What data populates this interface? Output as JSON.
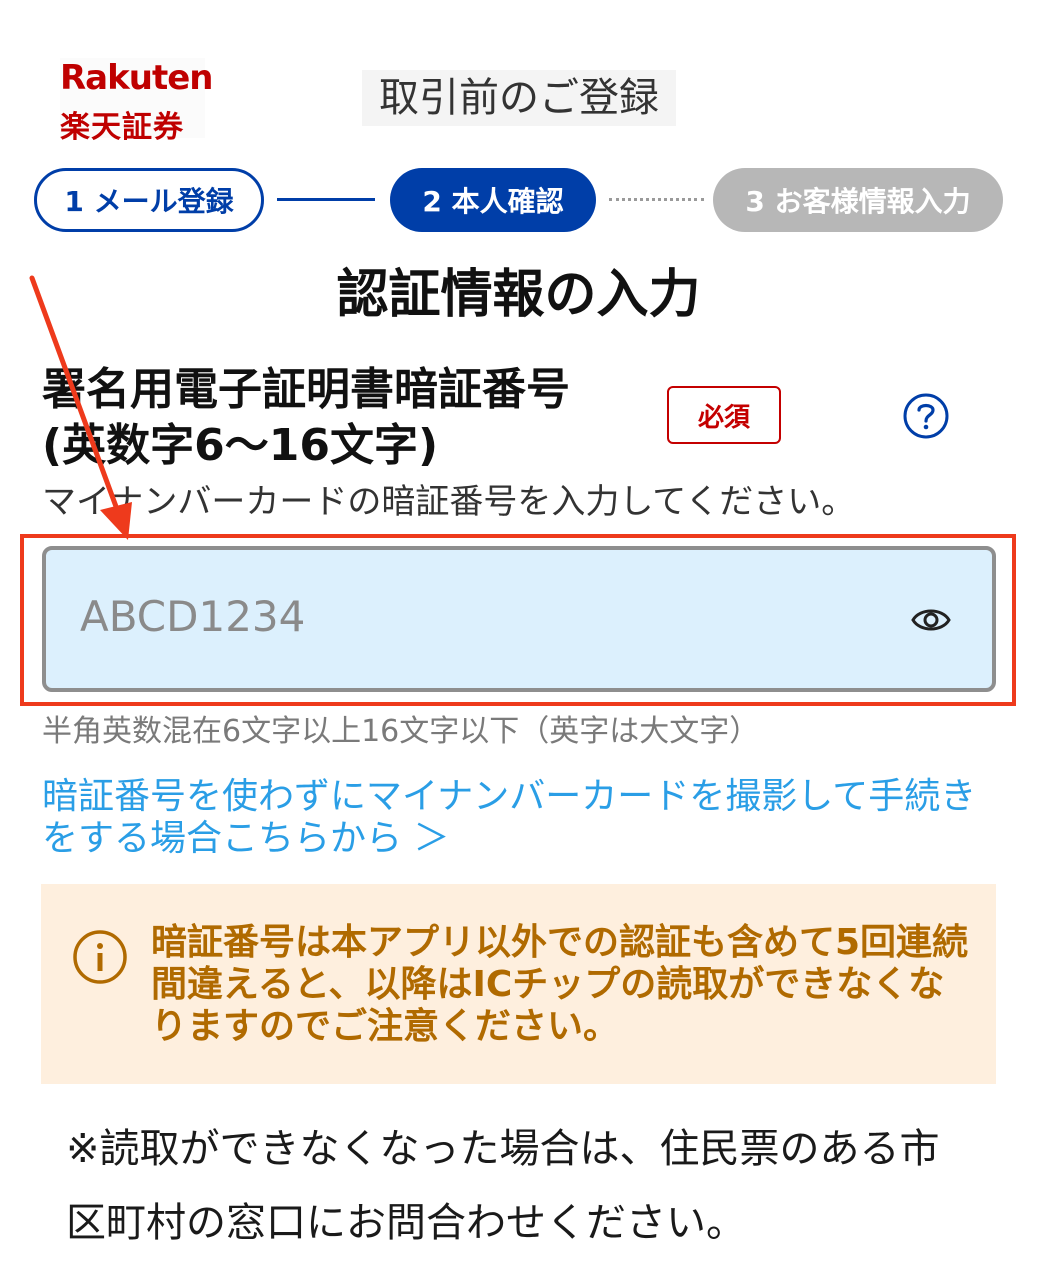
{
  "header": {
    "logo_en": "Rakuten",
    "logo_jp": "楽天証券",
    "title": "取引前のご登録"
  },
  "stepper": {
    "steps": [
      {
        "label": "1 メール登録",
        "state": "completed"
      },
      {
        "label": "2 本人確認",
        "state": "current"
      },
      {
        "label": "3 お客様情報入力",
        "state": "upcoming"
      }
    ]
  },
  "section_title": "認証情報の入力",
  "field": {
    "label_line1": "署名用電子証明書暗証番号",
    "label_line2": "(英数字6〜16文字)",
    "required": "必須",
    "help_icon": "question-circle-icon",
    "description": "マイナンバーカードの暗証番号を入力してください。",
    "placeholder": "ABCD1234",
    "toggle_icon": "eye-icon",
    "hint": "半角英数混在6文字以上16文字以下（英字は大文字）"
  },
  "link_text": "暗証番号を使わずにマイナンバーカードを撮影して手続きをする場合こちらから ＞",
  "warning": {
    "icon": "info-circle-icon",
    "text": "暗証番号は本アプリ以外での認証も含めて5回連続間違えると、以降はICチップの読取ができなくなりますのでご注意ください。"
  },
  "note": "※読取ができなくなった場合は、住民票のある市区町村の窓口にお問合わせください。",
  "colors": {
    "brand_red": "#bf0000",
    "primary_blue": "#003ea8",
    "link_blue": "#2a9ee6",
    "highlight_red": "#ee3a1c",
    "input_bg": "#dcf0fd",
    "warning_bg": "#feefde",
    "warning_text": "#b06a00"
  }
}
